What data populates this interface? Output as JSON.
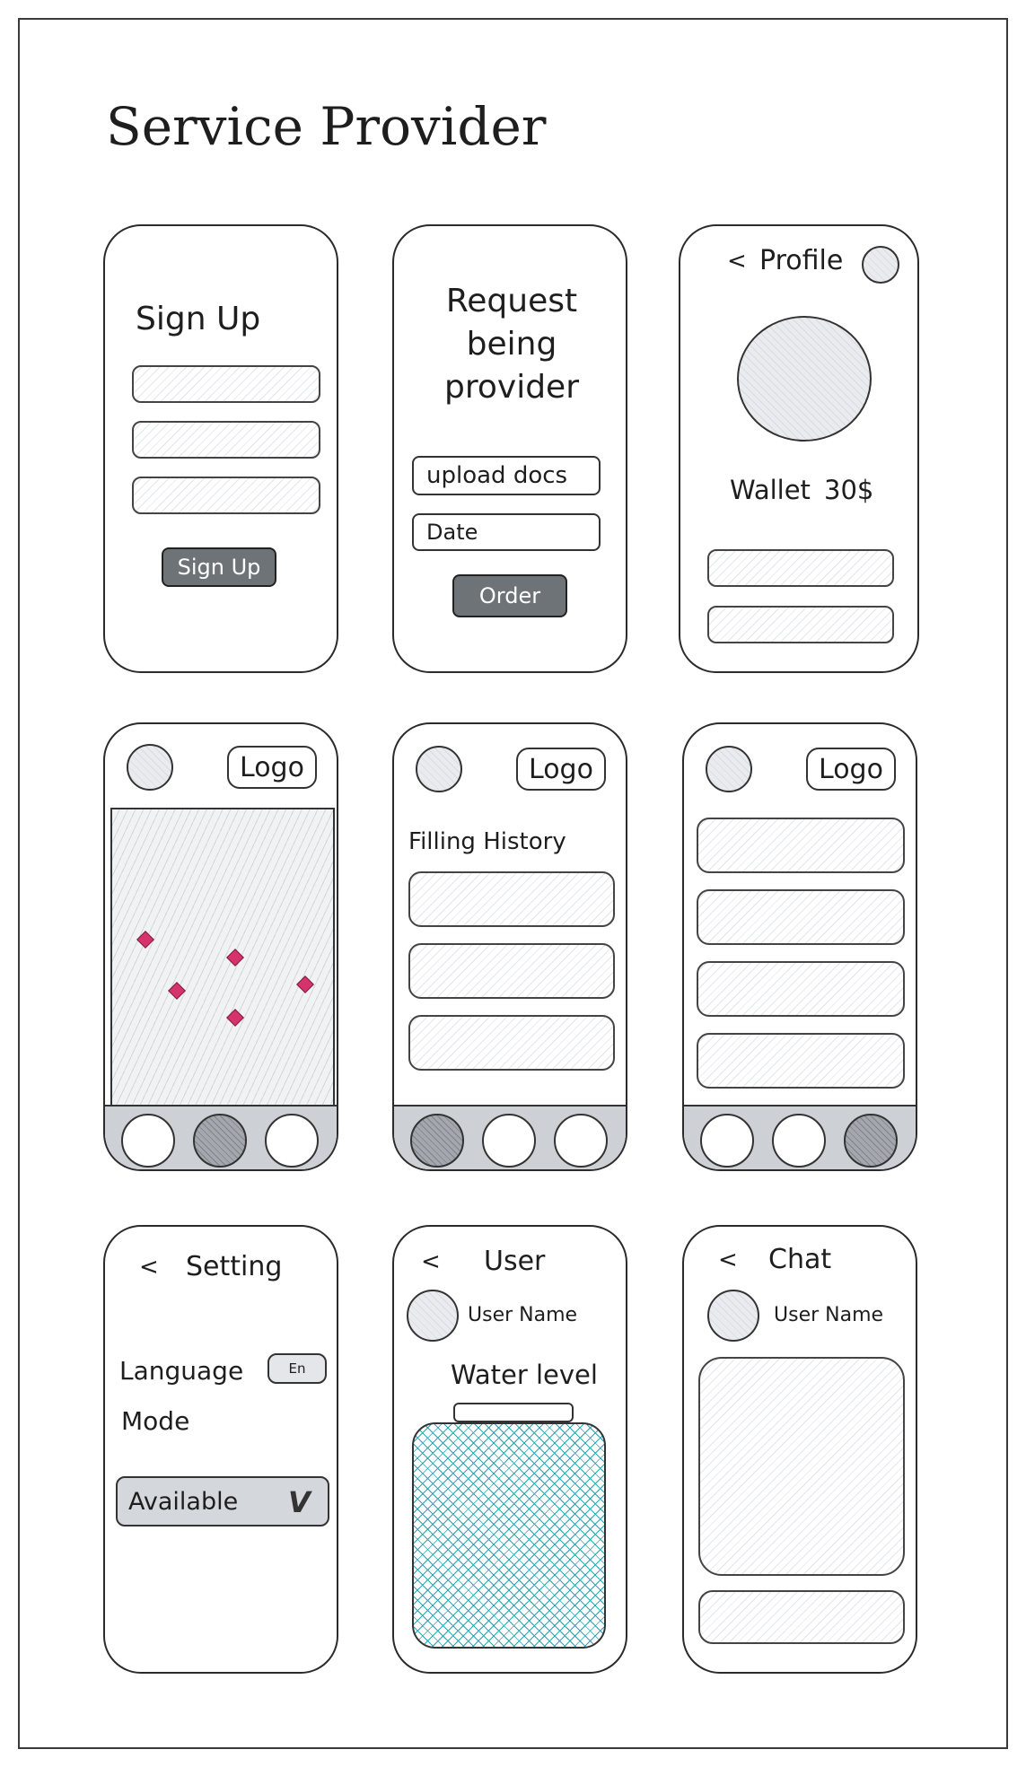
{
  "page": {
    "title": "Service Provider"
  },
  "signup": {
    "heading": "Sign Up",
    "button": "Sign Up"
  },
  "request": {
    "heading_l1": "Request",
    "heading_l2": "being",
    "heading_l3": "provider",
    "upload": "upload docs",
    "date": "Date",
    "order": "Order"
  },
  "profile": {
    "back": "<",
    "title": "Profile",
    "wallet_label": "Wallet",
    "wallet_value": "30$"
  },
  "map_screen": {
    "logo": "Logo"
  },
  "history": {
    "logo": "Logo",
    "heading": "Filling History"
  },
  "list_screen": {
    "logo": "Logo"
  },
  "setting": {
    "back": "<",
    "title": "Setting",
    "language": "Language",
    "lang_badge": "En",
    "mode": "Mode",
    "available": "Available",
    "check": "V"
  },
  "user": {
    "back": "<",
    "title": "User",
    "user_name": "User Name",
    "water_level": "Water level"
  },
  "chat": {
    "back": "<",
    "title": "Chat",
    "user_name": "User Name"
  },
  "icons": [
    "avatar-icon",
    "nav-home-icon",
    "nav-map-icon",
    "nav-list-icon",
    "back-icon",
    "map-pin-icon",
    "check-icon"
  ],
  "colors": {
    "dark_button": "#6e7378",
    "navbar": "#cdd1d6",
    "pin": "#d6336c",
    "water": "#2aa5b4"
  }
}
